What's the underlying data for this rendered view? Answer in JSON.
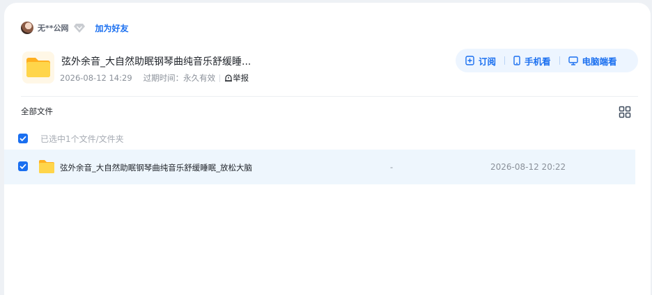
{
  "owner": {
    "name": "无**公网",
    "add_friend_label": "加为好友"
  },
  "share": {
    "title": "弦外余音_大自然助眠钢琴曲纯音乐舒缓睡...",
    "created": "2026-08-12 14:29",
    "expire_label": "过期时间：",
    "expire_value": "永久有效",
    "report_label": "举报"
  },
  "actions": [
    {
      "label": "订阅",
      "icon": "subscribe-icon"
    },
    {
      "label": "手机看",
      "icon": "phone-icon"
    },
    {
      "label": "电脑端看",
      "icon": "monitor-icon"
    }
  ],
  "file_list": {
    "breadcrumb": "全部文件",
    "selection_text": "已选中1个文件/文件夹",
    "view_toggle_icon": "grid-view-icon",
    "rows": [
      {
        "name": "弦外余音_大自然助眠钢琴曲纯音乐舒缓睡眠_放松大脑",
        "size": "-",
        "modified": "2026-08-12 20:22",
        "checked": true,
        "icon": "folder-icon"
      }
    ]
  },
  "colors": {
    "accent": "#1a6ff0",
    "row_selected_bg": "#eef6fd",
    "actions_bg": "#edf5ff",
    "folder": "#ffc53d"
  }
}
